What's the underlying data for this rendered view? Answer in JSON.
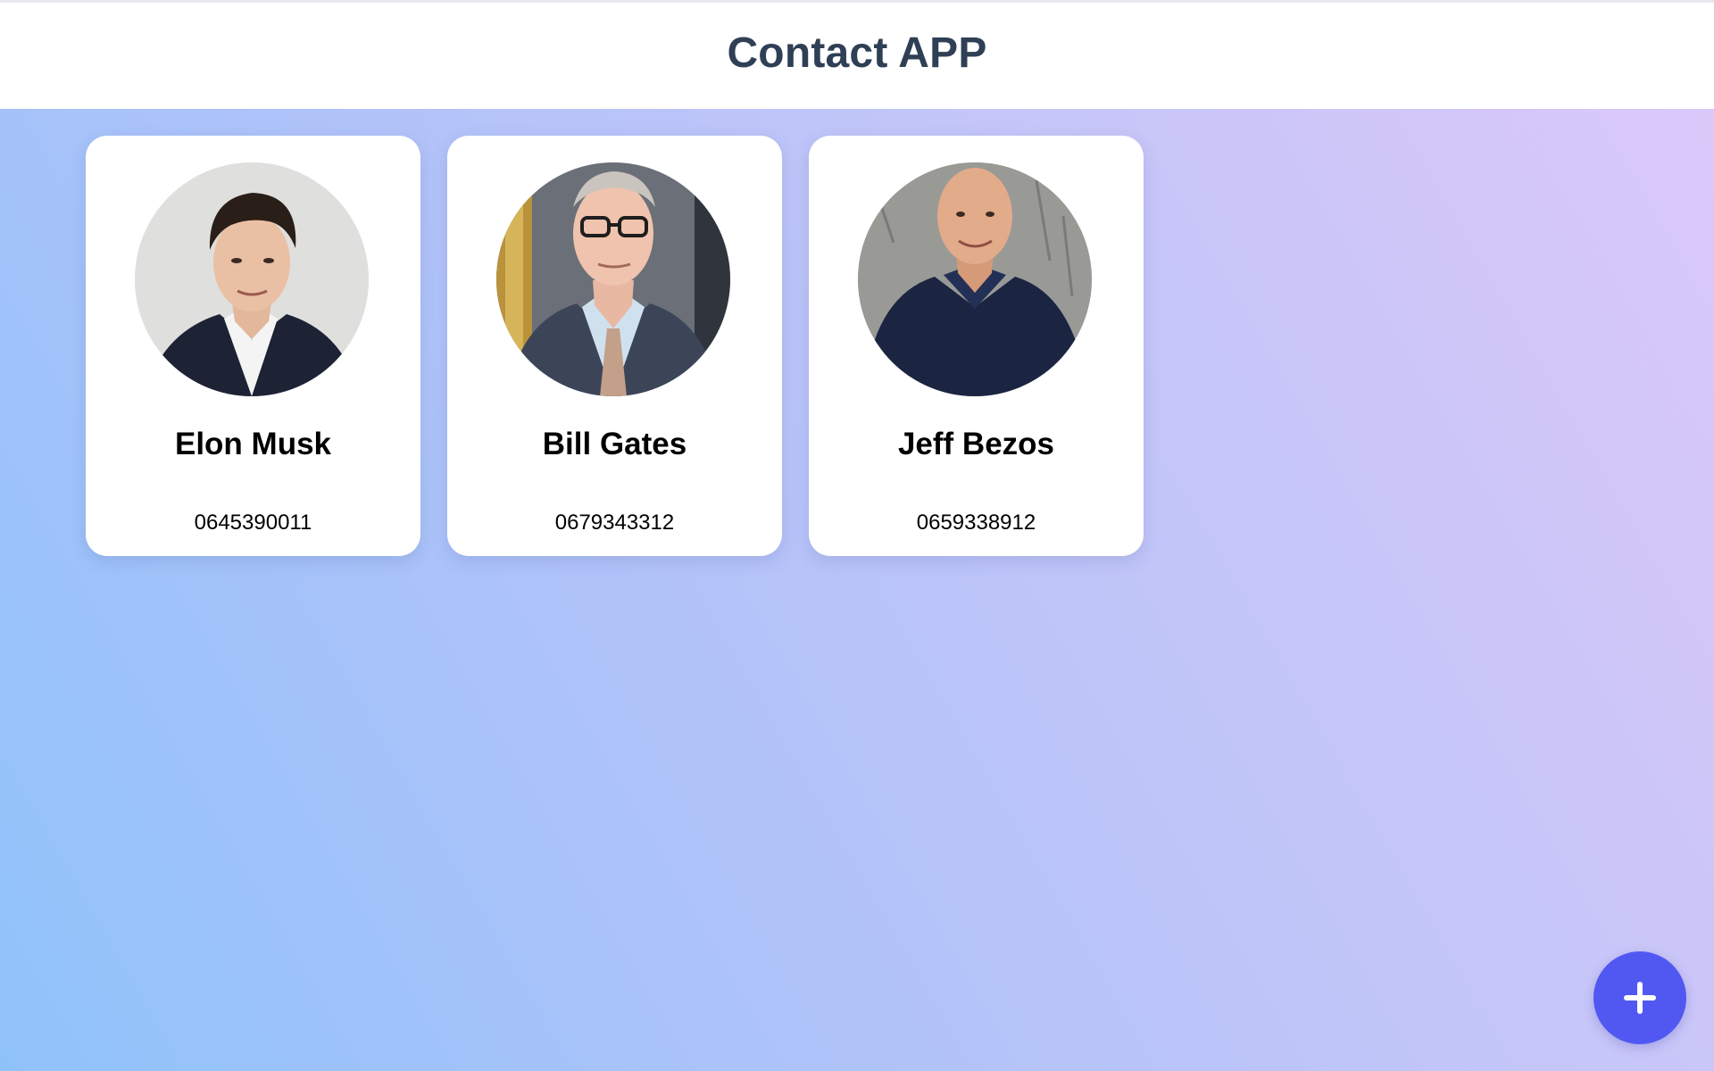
{
  "header": {
    "title": "Contact APP"
  },
  "contacts": [
    {
      "name": "Elon Musk",
      "phone": "0645390011",
      "avatar": "portrait-photo"
    },
    {
      "name": "Bill Gates",
      "phone": "0679343312",
      "avatar": "portrait-photo"
    },
    {
      "name": "Jeff Bezos",
      "phone": "0659338912",
      "avatar": "portrait-photo"
    }
  ],
  "fab": {
    "icon": "plus-icon",
    "color": "#5158f2"
  },
  "colors": {
    "title": "#2f3f55",
    "background_start": "#90c2fa",
    "background_end": "#dcc8f9",
    "card": "#ffffff"
  }
}
